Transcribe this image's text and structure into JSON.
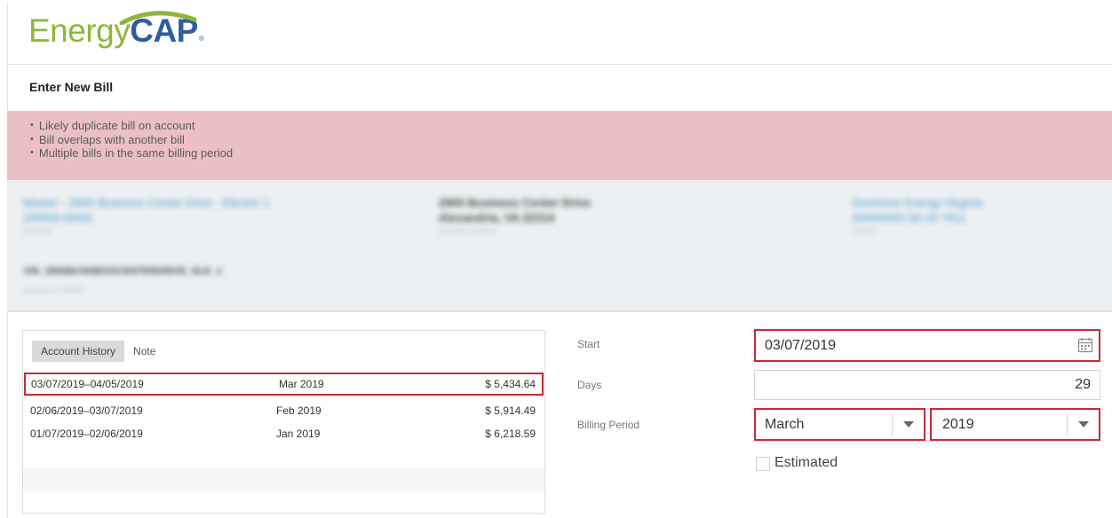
{
  "brand": {
    "logo_part1": "Energy",
    "logo_part2": "CAP",
    "logo_reg": "®",
    "green": "#8bb73a",
    "blue": "#2d5f9a"
  },
  "page": {
    "title": "Enter New Bill"
  },
  "alerts": [
    "Likely duplicate bill on account",
    "Bill overlaps with another bill",
    "Multiple bills in the same billing period"
  ],
  "info": {
    "account_link": [
      "Master - 2900 Business Center Drive - Electric 1",
      "(00000-0000)"
    ],
    "account_caption": "Account",
    "address": [
      "2900 Business Center Drive",
      "Alexandria, VA 22314"
    ],
    "address_caption": "Service address",
    "vendor_link": [
      "Dominion Energy Virginia",
      "(0000000) 00-18 7811"
    ],
    "vendor_caption": "Vendor",
    "meter_code": "VIN_2900BUSINESSCENTERDRIVE_ELE_1",
    "meter_caption": "Account to Meter"
  },
  "history": {
    "tabs": [
      {
        "label": "Account History",
        "active": true
      },
      {
        "label": "Note",
        "active": false
      }
    ],
    "rows": [
      {
        "range": "03/07/2019–04/05/2019",
        "period": "Mar 2019",
        "amount": "$ 5,434.64",
        "flagged": true
      },
      {
        "range": "02/06/2019–03/07/2019",
        "period": "Feb 2019",
        "amount": "$ 5,914.49",
        "flagged": false
      },
      {
        "range": "01/07/2019–02/06/2019",
        "period": "Jan 2019",
        "amount": "$ 6,218.59",
        "flagged": false
      }
    ]
  },
  "form": {
    "start_label": "Start",
    "start_value": "03/07/2019",
    "days_label": "Days",
    "days_value": "29",
    "billing_period_label": "Billing Period",
    "billing_month": "March",
    "billing_year": "2019",
    "estimated_label": "Estimated",
    "estimated_checked": false
  },
  "colors": {
    "alert_bg": "#eac0c4",
    "error_border": "#c32b36",
    "info_bg": "#edf0f2",
    "link": "#3d9ad1"
  }
}
